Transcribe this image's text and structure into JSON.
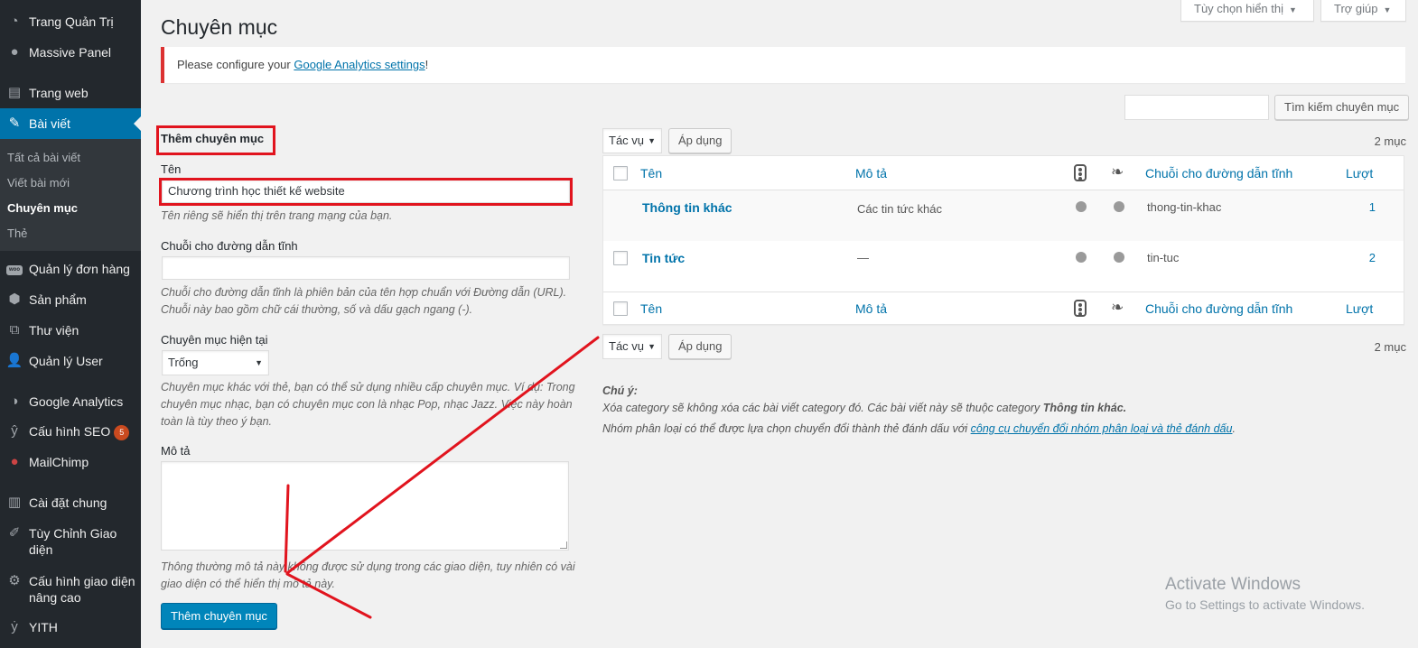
{
  "sidebar": {
    "items": [
      {
        "label": "Trang Quản Trị",
        "icon": "dashboard-icon"
      },
      {
        "label": "Massive Panel",
        "icon": "lightbulb-icon"
      },
      {
        "label": "Trang web",
        "icon": "pages-icon"
      },
      {
        "label": "Bài viết",
        "icon": "pin-icon"
      },
      {
        "label": "Quản lý đơn hàng",
        "icon": "woo-icon"
      },
      {
        "label": "Sản phẩm",
        "icon": "box-icon"
      },
      {
        "label": "Thư viện",
        "icon": "media-icon"
      },
      {
        "label": "Quản lý User",
        "icon": "user-icon"
      },
      {
        "label": "Google Analytics",
        "icon": "analytics-icon"
      },
      {
        "label": "Cấu hình SEO",
        "icon": "yoast-icon",
        "badge": "5"
      },
      {
        "label": "MailChimp",
        "icon": "mailchimp-icon"
      },
      {
        "label": "Cài đặt chung",
        "icon": "settings-icon"
      },
      {
        "label": "Tùy Chỉnh Giao diện",
        "icon": "brush-icon"
      },
      {
        "label": "Cấu hình giao diện nâng cao",
        "icon": "gear-icon"
      },
      {
        "label": "YITH",
        "icon": "yith-icon"
      }
    ],
    "submenu": [
      "Tất cả bài viết",
      "Viết bài mới",
      "Chuyên mục",
      "Thẻ"
    ]
  },
  "header": {
    "screen_options": "Tùy chọn hiển thị",
    "help": "Trợ giúp",
    "title": "Chuyên mục"
  },
  "notice": {
    "prefix": "Please configure your ",
    "link": "Google Analytics settings",
    "suffix": "!"
  },
  "search": {
    "value": "",
    "button": "Tìm kiếm chuyên mục"
  },
  "form": {
    "heading": "Thêm chuyên mục",
    "name_label": "Tên",
    "name_value": "Chương trình học thiết kế website",
    "name_desc": "Tên riêng sẽ hiển thị trên trang mạng của bạn.",
    "slug_label": "Chuỗi cho đường dẫn tĩnh",
    "slug_value": "",
    "slug_desc_1": "Chuỗi cho đường dẫn tĩnh là phiên bản của tên hợp chuẩn với Đường dẫn (URL).",
    "slug_desc_2": "Chuỗi này bao gồm chữ cái thường, số và dấu gạch ngang (-).",
    "parent_label": "Chuyên mục hiện tại",
    "parent_value": "Trống",
    "parent_desc_1": "Chuyên mục khác với thẻ, bạn có thể sử dụng nhiều cấp chuyên mục. Ví dụ: Trong",
    "parent_desc_2": "chuyên mục nhạc, bạn có chuyên mục con là nhạc Pop, nhạc Jazz. Việc này hoàn",
    "parent_desc_3": "toàn là tùy theo ý bạn.",
    "desc_label": "Mô tả",
    "desc_desc_1": "Thông thường mô tả này không được sử dụng trong các giao diện, tuy nhiên có vài",
    "desc_desc_2": "giao diện có thể hiển thị mô tả này.",
    "submit": "Thêm chuyên mục"
  },
  "bulk": {
    "action": "Tác vụ",
    "apply": "Áp dụng",
    "count": "2 mục"
  },
  "table": {
    "columns": [
      "Tên",
      "Mô tả",
      "Chuỗi cho đường dẫn tĩnh",
      "Lượt"
    ],
    "rows": [
      {
        "name": "Thông tin khác",
        "description": "Các tin tức khác",
        "slug": "thong-tin-khac",
        "count": "1"
      },
      {
        "name": "Tin tức",
        "description": "—",
        "slug": "tin-tuc",
        "count": "2"
      }
    ]
  },
  "notes": {
    "title": "Chú ý:",
    "line1_prefix": "Xóa category sẽ không xóa các bài viết category đó. Các bài viết này sẽ thuộc category ",
    "line1_bold": "Thông tin khác.",
    "line2_prefix": "Nhóm phân loại có thể được lựa chọn chuyển đổi thành thẻ đánh dấu với ",
    "line2_link": "công cụ chuyển đổi nhóm phân loại và thẻ đánh dấu",
    "line2_suffix": "."
  },
  "watermark": {
    "title": "Activate Windows",
    "subtitle": "Go to Settings to activate Windows."
  },
  "colors": {
    "sidebar": "#23282d",
    "accent": "#0073aa",
    "annotation": "#e1141e"
  }
}
